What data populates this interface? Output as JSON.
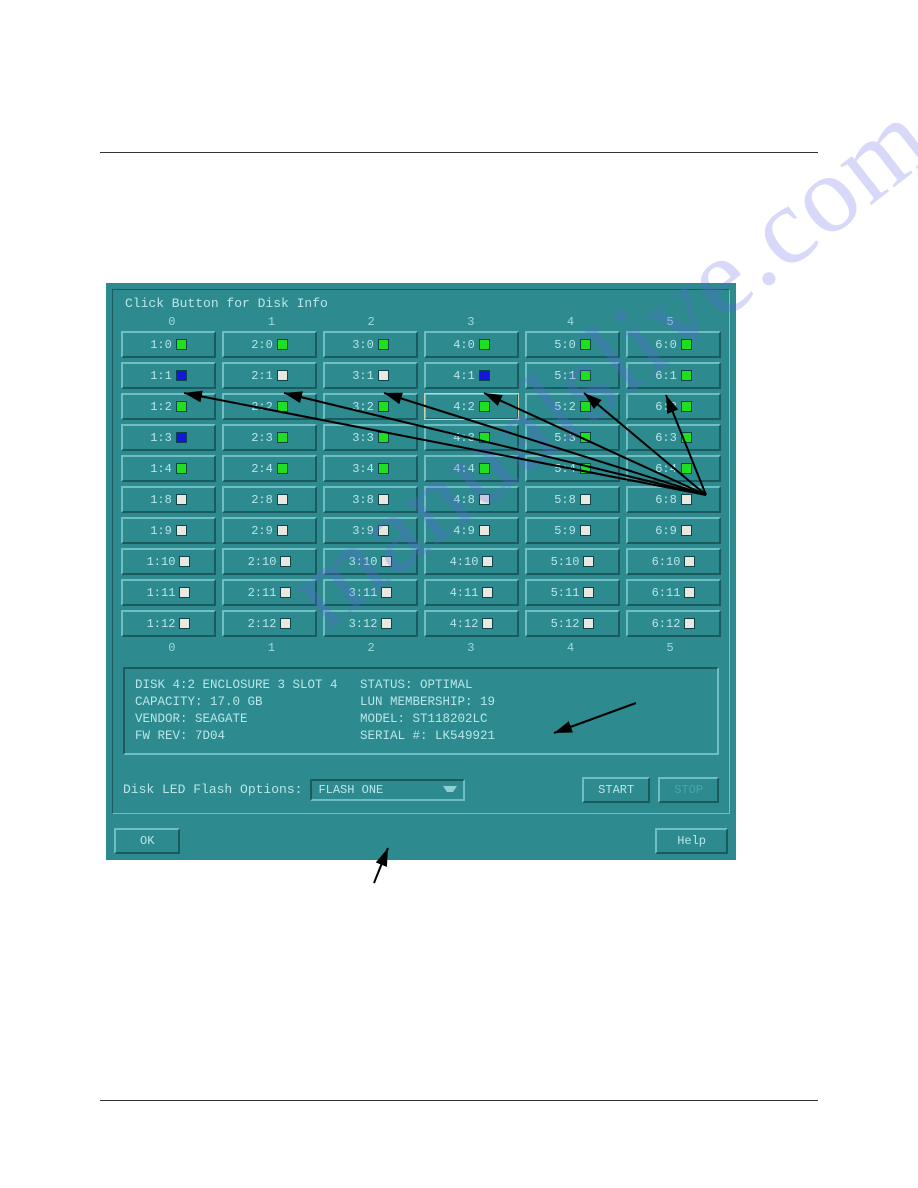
{
  "header_rule": true,
  "footer_rule": true,
  "watermark_text": "manualslive.com",
  "ui": {
    "title": "Click Button for Disk Info",
    "columns": [
      "0",
      "1",
      "2",
      "3",
      "4",
      "5"
    ],
    "rows": [
      [
        {
          "label": "1:0",
          "led": "green"
        },
        {
          "label": "2:0",
          "led": "green"
        },
        {
          "label": "3:0",
          "led": "green"
        },
        {
          "label": "4:0",
          "led": "green"
        },
        {
          "label": "5:0",
          "led": "green"
        },
        {
          "label": "6:0",
          "led": "green"
        }
      ],
      [
        {
          "label": "1:1",
          "led": "blue"
        },
        {
          "label": "2:1",
          "led": "off"
        },
        {
          "label": "3:1",
          "led": "off"
        },
        {
          "label": "4:1",
          "led": "blue"
        },
        {
          "label": "5:1",
          "led": "green"
        },
        {
          "label": "6:1",
          "led": "green"
        }
      ],
      [
        {
          "label": "1:2",
          "led": "green"
        },
        {
          "label": "2:2",
          "led": "green"
        },
        {
          "label": "3:2",
          "led": "green"
        },
        {
          "label": "4:2",
          "led": "green",
          "selected": true
        },
        {
          "label": "5:2",
          "led": "green"
        },
        {
          "label": "6:2",
          "led": "green"
        }
      ],
      [
        {
          "label": "1:3",
          "led": "blue"
        },
        {
          "label": "2:3",
          "led": "green"
        },
        {
          "label": "3:3",
          "led": "green"
        },
        {
          "label": "4:3",
          "led": "green"
        },
        {
          "label": "5:3",
          "led": "green"
        },
        {
          "label": "6:3",
          "led": "green"
        }
      ],
      [
        {
          "label": "1:4",
          "led": "green"
        },
        {
          "label": "2:4",
          "led": "green"
        },
        {
          "label": "3:4",
          "led": "green"
        },
        {
          "label": "4:4",
          "led": "green"
        },
        {
          "label": "5:4",
          "led": "green"
        },
        {
          "label": "6:4",
          "led": "green"
        }
      ],
      [
        {
          "label": "1:8",
          "led": "off"
        },
        {
          "label": "2:8",
          "led": "off"
        },
        {
          "label": "3:8",
          "led": "off"
        },
        {
          "label": "4:8",
          "led": "off"
        },
        {
          "label": "5:8",
          "led": "off"
        },
        {
          "label": "6:8",
          "led": "off"
        }
      ],
      [
        {
          "label": "1:9",
          "led": "off"
        },
        {
          "label": "2:9",
          "led": "off"
        },
        {
          "label": "3:9",
          "led": "off"
        },
        {
          "label": "4:9",
          "led": "off"
        },
        {
          "label": "5:9",
          "led": "off"
        },
        {
          "label": "6:9",
          "led": "off"
        }
      ],
      [
        {
          "label": "1:10",
          "led": "off"
        },
        {
          "label": "2:10",
          "led": "off"
        },
        {
          "label": "3:10",
          "led": "off"
        },
        {
          "label": "4:10",
          "led": "off"
        },
        {
          "label": "5:10",
          "led": "off"
        },
        {
          "label": "6:10",
          "led": "off"
        }
      ],
      [
        {
          "label": "1:11",
          "led": "off"
        },
        {
          "label": "2:11",
          "led": "off"
        },
        {
          "label": "3:11",
          "led": "off"
        },
        {
          "label": "4:11",
          "led": "off"
        },
        {
          "label": "5:11",
          "led": "off"
        },
        {
          "label": "6:11",
          "led": "off"
        }
      ],
      [
        {
          "label": "1:12",
          "led": "off"
        },
        {
          "label": "2:12",
          "led": "off"
        },
        {
          "label": "3:12",
          "led": "off"
        },
        {
          "label": "4:12",
          "led": "off"
        },
        {
          "label": "5:12",
          "led": "off"
        },
        {
          "label": "6:12",
          "led": "off"
        }
      ]
    ],
    "info": {
      "line1a": "DISK 4:2 ENCLOSURE 3 SLOT 4",
      "line1b": "STATUS: OPTIMAL",
      "line2a": "CAPACITY: 17.0 GB",
      "line2b": "LUN MEMBERSHIP: 19",
      "line3a": "VENDOR: SEAGATE",
      "line3b": "MODEL: ST118202LC",
      "line4a": "FW REV: 7D04",
      "line4b": "SERIAL #: LK549921"
    },
    "flash_label": "Disk LED Flash Options:",
    "flash_value": "FLASH ONE",
    "start_label": "START",
    "stop_label": "STOP",
    "ok_label": "OK",
    "help_label": "Help"
  }
}
